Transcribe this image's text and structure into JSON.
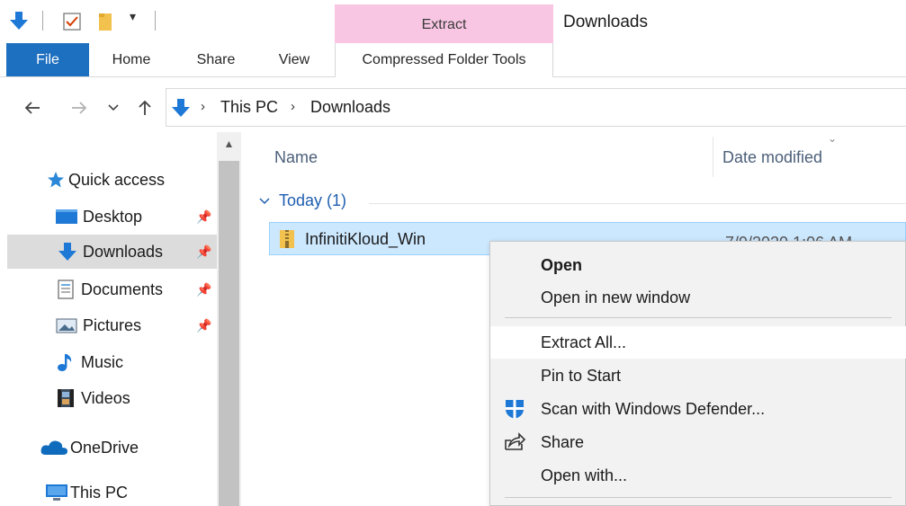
{
  "window": {
    "title": "Downloads"
  },
  "ribbon": {
    "context_group": "Extract",
    "tabs": [
      {
        "label": "File"
      },
      {
        "label": "Home"
      },
      {
        "label": "Share"
      },
      {
        "label": "View"
      },
      {
        "label": "Compressed Folder Tools"
      }
    ]
  },
  "address": {
    "crumbs": [
      "This PC",
      "Downloads"
    ]
  },
  "navpane": {
    "items": [
      {
        "label": "Quick access",
        "icon": "star-icon"
      },
      {
        "label": "Desktop",
        "icon": "desktop-folder-icon"
      },
      {
        "label": "Downloads",
        "icon": "download-arrow-icon"
      },
      {
        "label": "Documents",
        "icon": "documents-icon"
      },
      {
        "label": "Pictures",
        "icon": "pictures-icon"
      },
      {
        "label": "Music",
        "icon": "music-note-icon"
      },
      {
        "label": "Videos",
        "icon": "videos-icon"
      },
      {
        "label": "OneDrive",
        "icon": "cloud-icon"
      },
      {
        "label": "This PC",
        "icon": "computer-icon"
      }
    ]
  },
  "filelist": {
    "columns": [
      "Name",
      "Date modified"
    ],
    "group": "Today (1)",
    "files": [
      {
        "name": "InfinitiKloud_Win",
        "date": "7/9/2020 1:06 AM"
      }
    ]
  },
  "context_menu": {
    "items": [
      {
        "label": "Open"
      },
      {
        "label": "Open in new window"
      },
      {
        "label": "Extract All..."
      },
      {
        "label": "Pin to Start"
      },
      {
        "label": "Scan with Windows Defender..."
      },
      {
        "label": "Share"
      },
      {
        "label": "Open with..."
      }
    ]
  },
  "colors": {
    "accent": "#1d6fbf",
    "context_tab": "#f8c6e3",
    "selection": "#cce8ff"
  }
}
